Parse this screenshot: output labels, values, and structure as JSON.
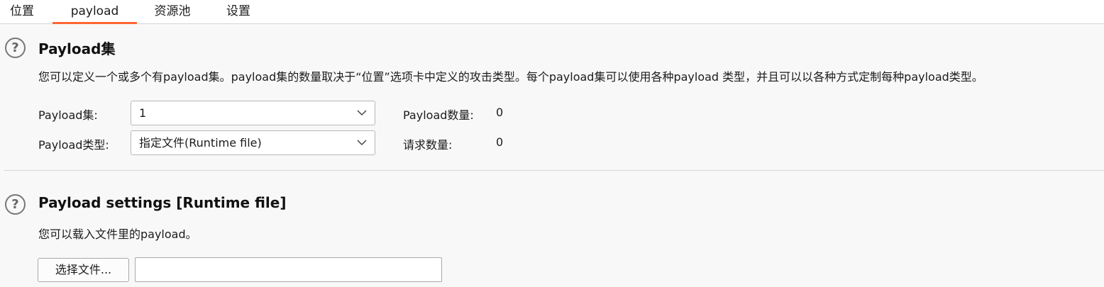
{
  "tabs": [
    {
      "label": "位置",
      "active": false
    },
    {
      "label": "payload",
      "active": true
    },
    {
      "label": "资源池",
      "active": false
    },
    {
      "label": "设置",
      "active": false
    }
  ],
  "accent_color": "#ff6633",
  "payload_sets": {
    "help_icon": "question-circle-icon",
    "title": "Payload集",
    "description": "您可以定义一个或多个有payload集。payload集的数量取决于“位置”选项卡中定义的攻击类型。每个payload集可以使用各种payload 类型，并且可以以各种方式定制每种payload类型。",
    "set_label": "Payload集:",
    "set_value": "1",
    "type_label": "Payload类型:",
    "type_value": "指定文件(Runtime file)",
    "count_label": "Payload数量:",
    "count_value": "0",
    "requests_label": "请求数量:",
    "requests_value": "0"
  },
  "payload_settings": {
    "help_icon": "question-circle-icon",
    "title": "Payload settings [Runtime file]",
    "description": "您可以载入文件里的payload。",
    "choose_file_label": "选择文件...",
    "file_path_value": ""
  }
}
